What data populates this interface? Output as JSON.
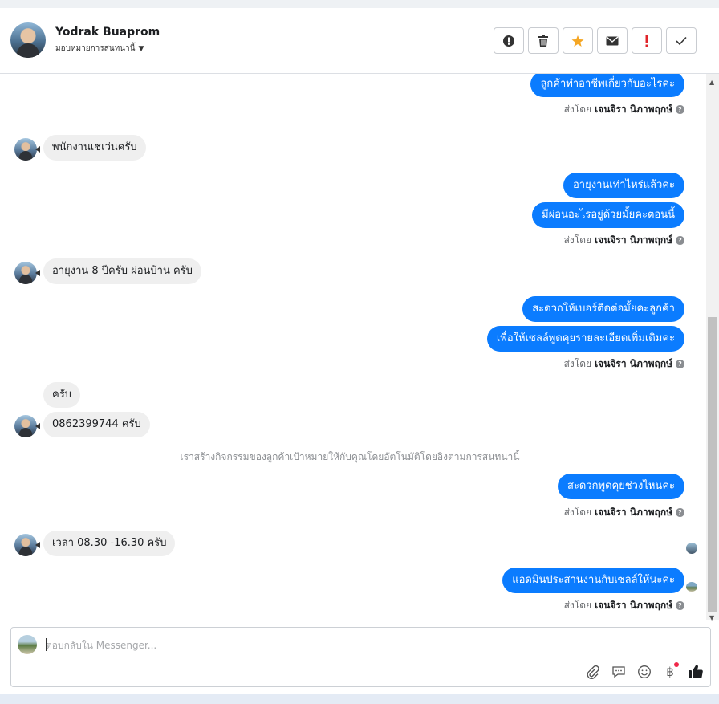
{
  "header": {
    "name": "Yodrak Buaprom",
    "assign_label": "มอบหมายการสนทนานี้",
    "toolbar": [
      {
        "name": "spam-button",
        "icon": "exclamation-circle-icon"
      },
      {
        "name": "delete-button",
        "icon": "trash-icon"
      },
      {
        "name": "star-button",
        "icon": "star-icon",
        "color": "#f5a623"
      },
      {
        "name": "mark-unread-button",
        "icon": "envelope-icon"
      },
      {
        "name": "mark-important-button",
        "icon": "exclamation-icon",
        "color": "#e0242a"
      },
      {
        "name": "mark-done-button",
        "icon": "check-icon"
      }
    ]
  },
  "messages": {
    "m1": "ลูกค้าทำอาชีพเกี่ยวกับอะไรคะ",
    "m2": "พนักงานเชเว่นครับ",
    "m3": "อายุงานเท่าไหร่แล้วคะ",
    "m4": "มีผ่อนอะไรอยู่ด้วยมั้ยคะตอนนี้",
    "m5": "อายุงาน 8 ปีครับ ผ่อนบ้าน ครับ",
    "m6": "สะดวกให้เบอร์ติดต่อมั้ยคะลูกค้า",
    "m7": "เพื่อให้เซลล์พูดคุยรายละเอียดเพิ่มเติมค่ะ",
    "m8": "ครับ",
    "m9": "0862399744 ครับ",
    "system": "เราสร้างกิจกรรมของลูกค้าเป้าหมายให้กับคุณโดยอัตโนมัติโดยอิงตามการสนทนานี้",
    "m10": "สะดวกพูดคุยช่วงไหนคะ",
    "m11": "เวลา 08.30 -16.30 ครับ",
    "m12": "แอดมินประสานงานกับเซลล์ให้นะคะ"
  },
  "sent_by": {
    "prefix": "ส่งโดย",
    "agent": "เจนจิรา นิภาพฤกษ์"
  },
  "composer": {
    "placeholder": "ตอบกลับใน Messenger...",
    "icons": [
      "paperclip-icon",
      "saved-replies-icon",
      "emoji-icon",
      "baht-icon",
      "thumbs-up-icon"
    ]
  },
  "colors": {
    "outgoing_bubble": "#0b7cff",
    "incoming_bubble": "#efefef",
    "star": "#f5a623",
    "important": "#e0242a"
  }
}
